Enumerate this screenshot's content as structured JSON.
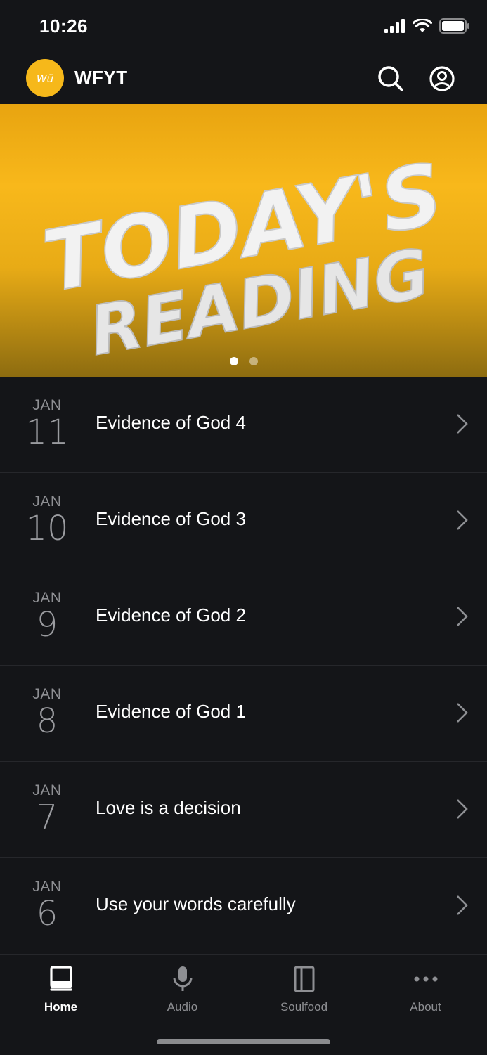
{
  "status_bar": {
    "time": "10:26"
  },
  "header": {
    "title": "WFYT",
    "logo_text": "Wü"
  },
  "hero": {
    "line1": "TODAY'S",
    "line2": "READING",
    "slide_count": 2,
    "active_slide": 1
  },
  "readings": [
    {
      "month": "JAN",
      "day": "11",
      "title": "Evidence of God 4"
    },
    {
      "month": "JAN",
      "day": "10",
      "title": "Evidence of God 3"
    },
    {
      "month": "JAN",
      "day": "9",
      "title": "Evidence of God 2"
    },
    {
      "month": "JAN",
      "day": "8",
      "title": "Evidence of God 1"
    },
    {
      "month": "JAN",
      "day": "7",
      "title": "Love is a decision"
    },
    {
      "month": "JAN",
      "day": "6",
      "title": "Use your words carefully"
    }
  ],
  "tabs": [
    {
      "label": "Home",
      "icon": "book-icon",
      "active": true
    },
    {
      "label": "Audio",
      "icon": "microphone-icon",
      "active": false
    },
    {
      "label": "Soulfood",
      "icon": "notebook-icon",
      "active": false
    },
    {
      "label": "About",
      "icon": "more-icon",
      "active": false
    }
  ],
  "colors": {
    "accent": "#f6b81a",
    "background": "#141518"
  }
}
